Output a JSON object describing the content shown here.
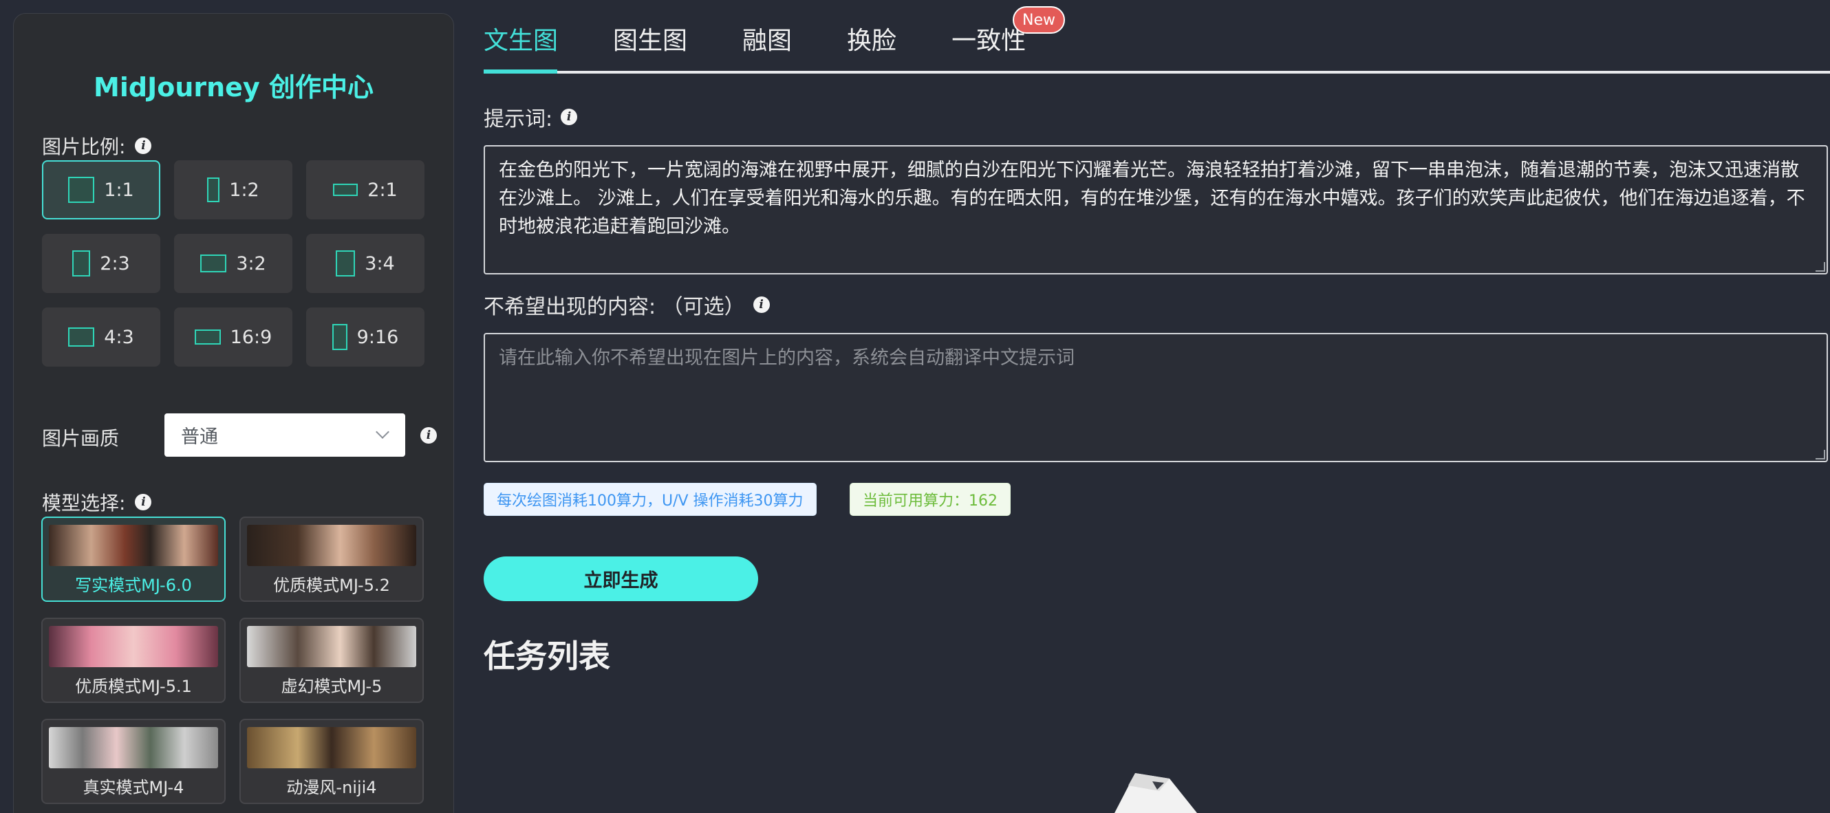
{
  "sidebar": {
    "title": "MidJourney 创作中心",
    "ratio_label": "图片比例:",
    "ratios": [
      {
        "label": "1:1",
        "active": true
      },
      {
        "label": "1:2",
        "active": false
      },
      {
        "label": "2:1",
        "active": false
      },
      {
        "label": "2:3",
        "active": false
      },
      {
        "label": "3:2",
        "active": false
      },
      {
        "label": "3:4",
        "active": false
      },
      {
        "label": "4:3",
        "active": false
      },
      {
        "label": "16:9",
        "active": false
      },
      {
        "label": "9:16",
        "active": false
      }
    ],
    "quality_label": "图片画质",
    "quality_value": "普通",
    "model_label": "模型选择:",
    "models": [
      {
        "name": "写实模式MJ-6.0",
        "active": true
      },
      {
        "name": "优质模式MJ-5.2",
        "active": false
      },
      {
        "name": "优质模式MJ-5.1",
        "active": false
      },
      {
        "name": "虚幻模式MJ-5",
        "active": false
      },
      {
        "name": "真实模式MJ-4",
        "active": false
      },
      {
        "name": "动漫风-niji4",
        "active": false
      }
    ]
  },
  "tabs": [
    {
      "label": "文生图",
      "active": true
    },
    {
      "label": "图生图",
      "active": false
    },
    {
      "label": "融图",
      "active": false
    },
    {
      "label": "换脸",
      "active": false
    },
    {
      "label": "一致性",
      "active": false
    }
  ],
  "new_badge": "New",
  "prompt": {
    "label": "提示词:",
    "value": "在金色的阳光下，一片宽阔的海滩在视野中展开，细腻的白沙在阳光下闪耀着光芒。海浪轻轻拍打着沙滩，留下一串串泡沫，随着退潮的节奏，泡沫又迅速消散在沙滩上。 沙滩上，人们在享受着阳光和海水的乐趣。有的在晒太阳，有的在堆沙堡，还有的在海水中嬉戏。孩子们的欢笑声此起彼伏，他们在海边追逐着，不时地被浪花追赶着跑回沙滩。"
  },
  "negative": {
    "label": "不希望出现的内容: （可选）",
    "placeholder": "请在此输入你不希望出现在图片上的内容，系统会自动翻译中文提示词"
  },
  "cost_tag": "每次绘图消耗100算力，U/V 操作消耗30算力",
  "balance_tag": "当前可用算力：162",
  "generate_button": "立即生成",
  "task_list_title": "任务列表",
  "colors": {
    "accent": "#4bf0e6",
    "badge": "#e35a57",
    "background": "#272b36"
  }
}
